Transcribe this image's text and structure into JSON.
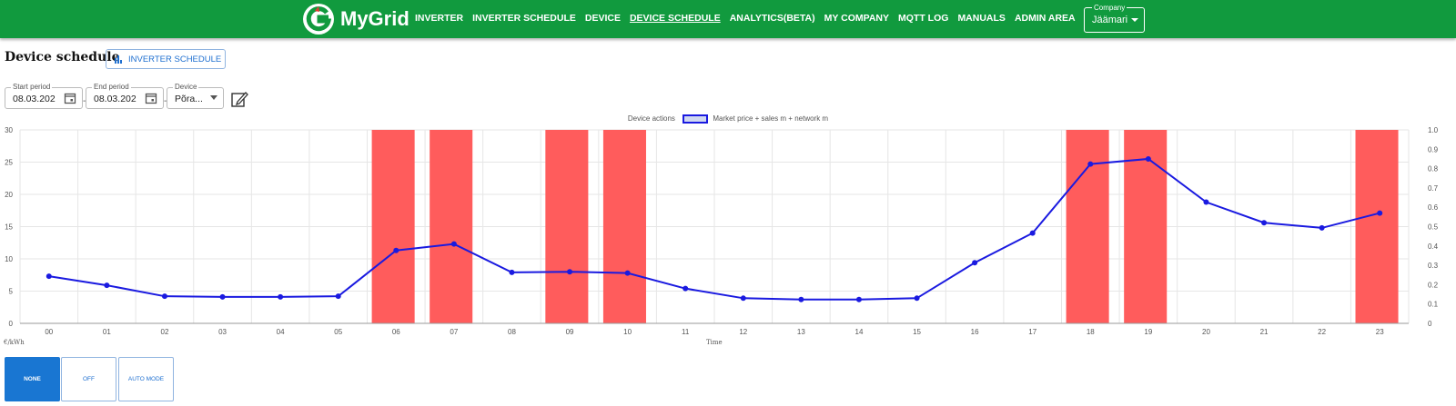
{
  "app": {
    "brand": "MyGrid"
  },
  "nav": [
    "INVERTER",
    "INVERTER SCHEDULE",
    "DEVICE",
    "DEVICE SCHEDULE",
    "ANALYTICS(BETA)",
    "MY COMPANY",
    "MQTT LOG",
    "MANUALS",
    "ADMIN AREA"
  ],
  "nav_active": "DEVICE SCHEDULE",
  "company": {
    "label": "Company",
    "value": "Jäämari"
  },
  "page": {
    "title": "Device schedule",
    "inverter_button": "INVERTER SCHEDULE"
  },
  "filters": {
    "start": {
      "label": "Start period",
      "value": "08.03.202"
    },
    "end": {
      "label": "End period",
      "value": "08.03.202"
    },
    "device": {
      "label": "Device",
      "value": "Põra..."
    }
  },
  "colors": {
    "brand": "#119a3e",
    "line": "#1a1ae0",
    "action": "#ff5c5c",
    "button": "#1976d2"
  },
  "chart_data": {
    "type": "line",
    "x": [
      "00",
      "01",
      "02",
      "03",
      "04",
      "05",
      "06",
      "07",
      "08",
      "09",
      "10",
      "11",
      "12",
      "13",
      "14",
      "15",
      "16",
      "17",
      "18",
      "19",
      "20",
      "21",
      "22",
      "23"
    ],
    "series": [
      {
        "name": "Market price + sales m + network m",
        "values": [
          7.3,
          5.9,
          4.2,
          4.1,
          4.1,
          4.2,
          11.3,
          12.3,
          7.9,
          8.0,
          7.8,
          5.4,
          3.9,
          3.7,
          3.7,
          3.9,
          9.4,
          14.0,
          24.7,
          25.5,
          18.8,
          15.6,
          14.8,
          17.1
        ]
      }
    ],
    "actions": {
      "name": "Device actions",
      "hours": [
        "06",
        "07",
        "09",
        "10",
        "18",
        "19",
        "23"
      ]
    },
    "ylim": [
      0,
      30
    ],
    "y_ticks": [
      0,
      5,
      10,
      15,
      20,
      25,
      30
    ],
    "y2lim": [
      0,
      1
    ],
    "y2_ticks": [
      "0",
      "0.1",
      "0.2",
      "0.3",
      "0.4",
      "0.5",
      "0.6",
      "0.7",
      "0.8",
      "0.9",
      "1.0"
    ],
    "ylabel": "€/kWh",
    "xlabel": "Time",
    "grid": true,
    "legend": "top-center"
  },
  "modes": [
    {
      "label": "NONE",
      "selected": true
    },
    {
      "label": "OFF",
      "selected": false
    },
    {
      "label": "AUTO MODE",
      "selected": false
    }
  ]
}
